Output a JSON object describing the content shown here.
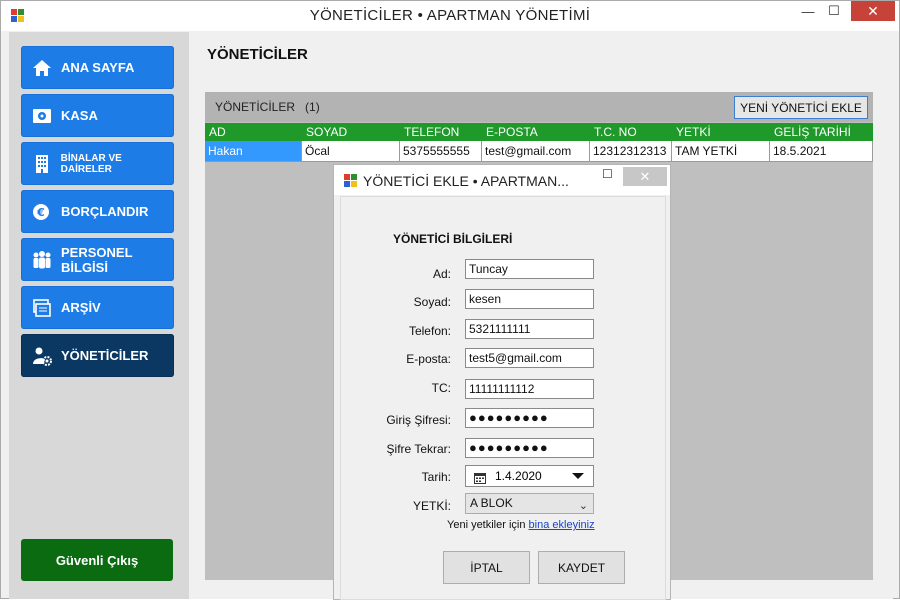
{
  "window": {
    "title": "YÖNETİCİLER • APARTMAN YÖNETİMİ",
    "minimize": "—",
    "maximize": "☐",
    "close": "✕"
  },
  "sidebar": {
    "items": [
      {
        "label": "ANA SAYFA",
        "icon": "home-icon"
      },
      {
        "label": "KASA",
        "icon": "safe-icon"
      },
      {
        "label": "BİNALAR VE DAİRELER",
        "icon": "building-icon"
      },
      {
        "label": "BORÇLANDIR",
        "icon": "money-icon"
      },
      {
        "label": "PERSONEL BİLGİSİ",
        "icon": "people-icon"
      },
      {
        "label": "ARŞİV",
        "icon": "archive-icon"
      },
      {
        "label": "YÖNETİCİLER",
        "icon": "admin-gear-icon",
        "active": true
      }
    ],
    "exit_label": "Güvenli Çıkış"
  },
  "main": {
    "title": "YÖNETİCİLER",
    "panel_label": "YÖNETİCİLER",
    "count": "(1)",
    "add_button": "YENİ YÖNETİCİ EKLE",
    "columns": [
      "AD",
      "SOYAD",
      "TELEFON",
      "E-POSTA",
      "T.C. NO",
      "YETKİ",
      "GELİŞ TARİHİ"
    ],
    "rows": [
      [
        "Hakan",
        "Öcal",
        "5375555555",
        "test@gmail.com",
        "12312312313",
        "TAM YETKİ",
        "18.5.2021"
      ]
    ]
  },
  "dialog": {
    "title": "YÖNETİCİ EKLE • APARTMAN...",
    "maximize": "☐",
    "close": "✕",
    "section_title": "YÖNETİCİ BİLGİLERİ",
    "fields": {
      "ad": {
        "label": "Ad:",
        "value": "Tuncay"
      },
      "soyad": {
        "label": "Soyad:",
        "value": "kesen"
      },
      "telefon": {
        "label": "Telefon:",
        "value": "5321111111"
      },
      "eposta": {
        "label": "E-posta:",
        "value": "test5@gmail.com"
      },
      "tc": {
        "label": "TC:",
        "value": "11111111112"
      },
      "sifre": {
        "label": "Giriş Şifresi:",
        "value": "●●●●●●●●●"
      },
      "sifre_tekrar": {
        "label": "Şifre Tekrar:",
        "value": "●●●●●●●●●"
      },
      "tarih": {
        "label": "Tarih:",
        "value": "1.4.2020"
      },
      "yetki": {
        "label": "YETKİ:",
        "value": "A BLOK"
      }
    },
    "hint_text": "Yeni yetkiler için",
    "hint_link": "bina ekleyiniz",
    "cancel_button": "İPTAL",
    "save_button": "KAYDET"
  },
  "colors": {
    "nav_blue": "#1e7ce6",
    "nav_active": "#0b3863",
    "exit_green": "#0a6b10",
    "grid_header_green": "#1f9a2a",
    "selected_cell": "#3399ff",
    "close_red": "#c7433a"
  }
}
